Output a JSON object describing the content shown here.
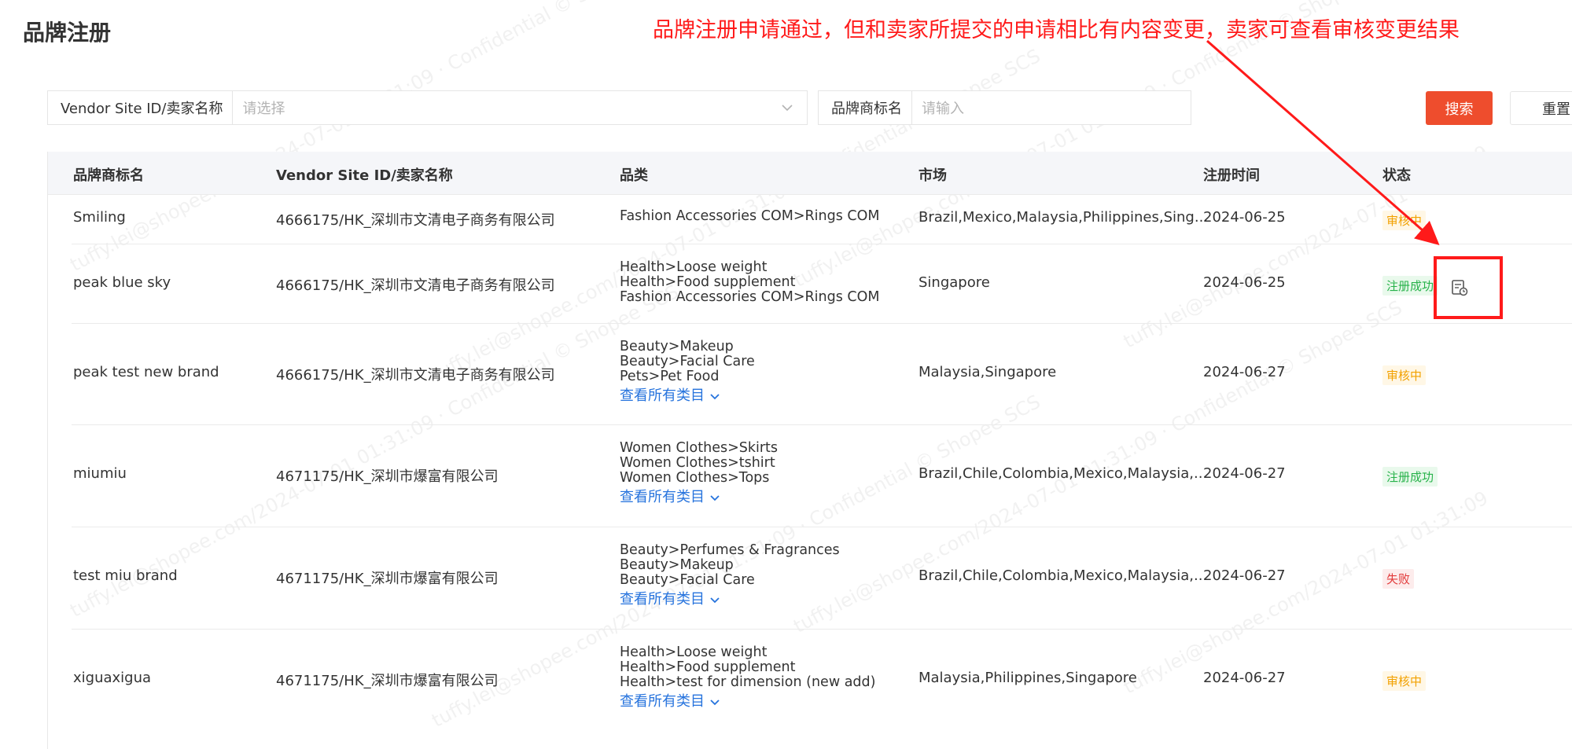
{
  "page": {
    "title": "品牌注册"
  },
  "annotation": {
    "text": "品牌注册申请通过，但和卖家所提交的申请相比有内容变更，卖家可查看审核变更结果"
  },
  "filters": {
    "vendor_label": "Vendor Site ID/卖家名称",
    "vendor_placeholder": "请选择",
    "brand_label": "品牌商标名",
    "brand_placeholder": "请输入",
    "search_label": "搜索",
    "reset_label": "重置"
  },
  "table": {
    "headers": [
      "品牌商标名",
      "Vendor Site ID/卖家名称",
      "品类",
      "市场",
      "注册时间",
      "状态"
    ],
    "rows": [
      {
        "brand": "Smiling",
        "vendor": "4666175/HK_深圳市文清电子商务有限公司",
        "categories": [
          "Fashion Accessories COM>Rings COM"
        ],
        "view_all": "",
        "market": "Brazil,Mexico,Malaysia,Philippines,Sing...",
        "date": "2024-06-25",
        "status": "审核中"
      },
      {
        "brand": "peak blue sky",
        "vendor": "4666175/HK_深圳市文清电子商务有限公司",
        "categories": [
          "Health>Loose weight",
          "Health>Food supplement",
          "Fashion Accessories COM>Rings COM"
        ],
        "view_all": "",
        "market": "Singapore",
        "date": "2024-06-25",
        "status": "注册成功"
      },
      {
        "brand": "peak test new brand",
        "vendor": "4666175/HK_深圳市文清电子商务有限公司",
        "categories": [
          "Beauty>Makeup",
          "Beauty>Facial Care",
          "Pets>Pet Food"
        ],
        "view_all": "查看所有类目",
        "market": "Malaysia,Singapore",
        "date": "2024-06-27",
        "status": "审核中"
      },
      {
        "brand": "miumiu",
        "vendor": "4671175/HK_深圳市爆富有限公司",
        "categories": [
          "Women Clothes>Skirts",
          "Women Clothes>tshirt",
          "Women Clothes>Tops"
        ],
        "view_all": "查看所有类目",
        "market": "Brazil,Chile,Colombia,Mexico,Malaysia,...",
        "date": "2024-06-27",
        "status": "注册成功"
      },
      {
        "brand": "test miu brand",
        "vendor": "4671175/HK_深圳市爆富有限公司",
        "categories": [
          "Beauty>Perfumes & Fragrances",
          "Beauty>Makeup",
          "Beauty>Facial Care"
        ],
        "view_all": "查看所有类目",
        "market": "Brazil,Chile,Colombia,Mexico,Malaysia,...",
        "date": "2024-06-27",
        "status": "失败"
      },
      {
        "brand": "xiguaxigua",
        "vendor": "4671175/HK_深圳市爆富有限公司",
        "categories": [
          "Health>Loose weight",
          "Health>Food supplement",
          "Health>test for dimension (new add)"
        ],
        "view_all": "查看所有类目",
        "market": "Malaysia,Philippines,Singapore",
        "date": "2024-06-27",
        "status": "审核中"
      }
    ]
  },
  "colors": {
    "accent": "#ee4d2d",
    "annotation": "#ff1a1a",
    "link": "#2673dd",
    "status_review": "#f2a100",
    "status_success": "#27b24a",
    "status_fail": "#e23a3a"
  },
  "icons": {
    "dropdown": "chevron-down-icon",
    "expand": "chevron-down-icon",
    "audit_result": "document-clock-icon"
  }
}
